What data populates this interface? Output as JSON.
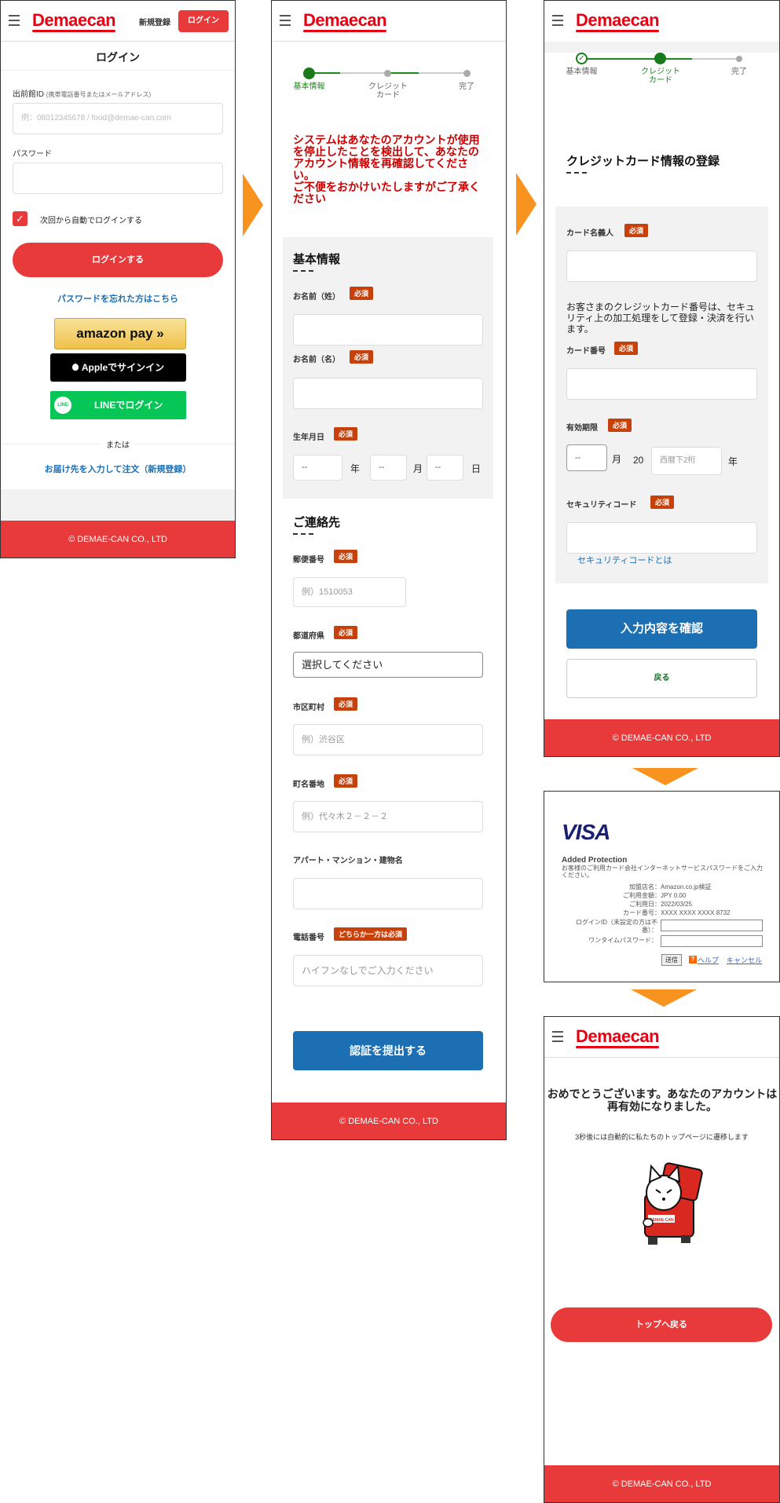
{
  "brand": {
    "logo": "Demaecan",
    "color": "#e60012",
    "footer": "© DEMAE-CAN CO., LTD"
  },
  "login": {
    "register": "新規登録",
    "login_btn": "ログイン",
    "title": "ログイン",
    "id_label": "出前館ID",
    "id_hint": "(携帯電話番号またはメールアドレス)",
    "id_placeholder": "例：08012345678 / food@demae-can.com",
    "pw_label": "パスワード",
    "auto_login": "次回から自動でログインする",
    "submit": "ログインする",
    "forgot": "パスワードを忘れた方はこちら",
    "amazon": "amazon pay",
    "apple": "Appleでサインイン",
    "line": "LINEでログイン",
    "line_logo": "LINE",
    "or": "または",
    "guest": "お届け先を入力して注文（新規登録）"
  },
  "steps": {
    "s1": "基本情報",
    "s2a": "クレジット",
    "s2b": "カード",
    "s3": "完了"
  },
  "form": {
    "warning": "システムはあなたのアカウントが使用を停止したことを検出して、あなたのアカウント情報を再確認してください。\nご不便をおかけいたしますがご了承ください",
    "basic_title": "基本情報",
    "last_name": "お名前（姓）",
    "first_name": "お名前（名）",
    "required": "必須",
    "birth": "生年月日",
    "dash": "--",
    "year": "年",
    "month": "月",
    "day": "日",
    "contact_title": "ご連絡先",
    "zip": "郵便番号",
    "zip_ph": "例）1510053",
    "pref": "都道府県",
    "pref_value": "選択してください",
    "city": "市区町村",
    "city_ph": "例）渋谷区",
    "street": "町名番地",
    "street_ph": "例）代々木２－２－２",
    "building": "アパート・マンション・建物名",
    "phone": "電話番号",
    "phone_req": "どちらか一方は必須",
    "phone_ph": "ハイフンなしでご入力ください",
    "submit": "認証を提出する"
  },
  "card": {
    "title": "クレジットカード情報の登録",
    "holder": "カード名義人",
    "note": "お客さまのクレジットカード番号は、セキュリティ上の加工処理をして登録・決済を行います。",
    "number": "カード番号",
    "expiry": "有効期限",
    "month": "月",
    "twenty": "20",
    "year_ph": "西暦下2桁",
    "year": "年",
    "cvc": "セキュリティコード",
    "cvc_link": "セキュリティコードとは",
    "confirm": "入力内容を確認",
    "back": "戻る"
  },
  "visa": {
    "logo": "VISA",
    "heading": "Added Protection",
    "desc": "お客様のご利用カード会社インターネットサービスパスワードをご入力ください。",
    "rows": [
      {
        "k": "加盟店名：",
        "v": "Amazon.co.jp検証"
      },
      {
        "k": "ご利用金額：",
        "v": "JPY 0.00"
      },
      {
        "k": "ご利用日：",
        "v": "2022/03/25"
      },
      {
        "k": "カード番号：",
        "v": "XXXX XXXX XXXX 8732"
      }
    ],
    "login_id": "ログインID（未設定の方は不番）：",
    "otp": "ワンタイムパスワード：",
    "send": "送信",
    "help": "ヘルプ",
    "cancel": "キャンセル"
  },
  "done": {
    "title": "おめでとうございます。あなたのアカウントは再有効になりました。",
    "sub": "3秒後には自動的に私たちのトップページに遷移します",
    "box_label": "DEMAE-CAN",
    "btn": "トップへ戻る"
  }
}
